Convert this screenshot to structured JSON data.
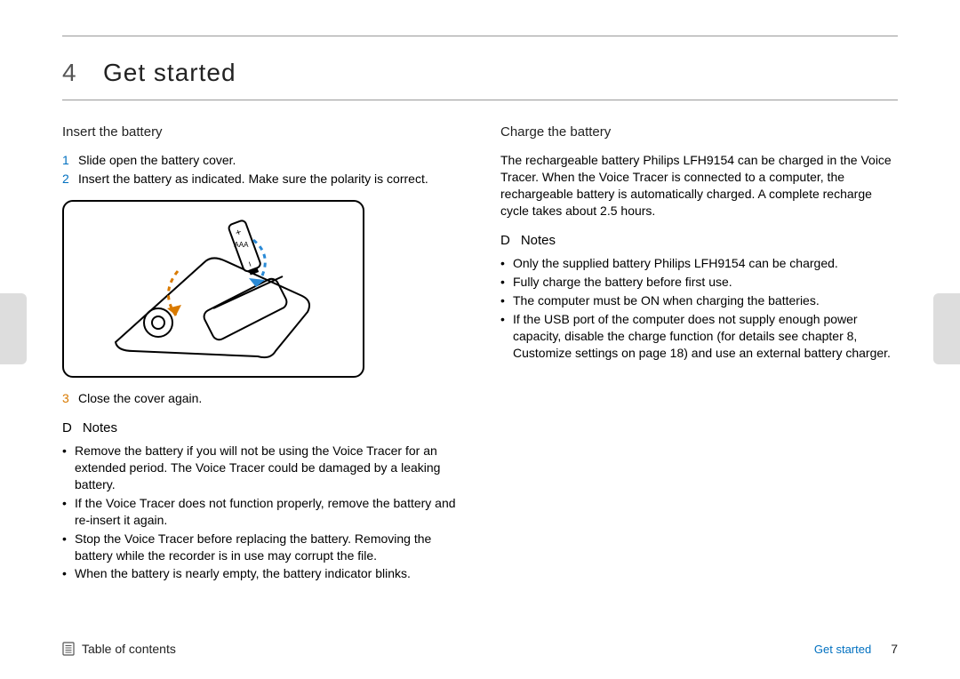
{
  "chapter": {
    "number": "4",
    "title": "Get started"
  },
  "left": {
    "subhead": "Insert the battery",
    "steps": [
      {
        "n": "1",
        "color": "blue",
        "text": "Slide open the battery cover."
      },
      {
        "n": "2",
        "color": "blue",
        "text": "Insert the battery as indicated. Make sure the polarity is correct."
      },
      {
        "n": "3",
        "color": "orange",
        "text": "Close the cover again."
      }
    ],
    "notes_symbol": "D",
    "notes_label": "Notes",
    "notes": [
      "Remove the battery if you will not be using the Voice Tracer for an extended period. The Voice Tracer could be damaged by a leaking battery.",
      "If the Voice Tracer does not function properly, remove the battery and re-insert it again.",
      "Stop the Voice Tracer before replacing the battery. Removing the battery while the recorder is in use may corrupt the file.",
      "When the battery is nearly empty, the battery indicator blinks."
    ]
  },
  "right": {
    "subhead": "Charge the battery",
    "para": "The rechargeable battery Philips LFH9154 can be charged in the Voice Tracer. When the Voice Tracer is connected to a computer, the rechargeable battery is automatically charged. A complete recharge cycle takes about 2.5 hours.",
    "notes_symbol": "D",
    "notes_label": "Notes",
    "notes": [
      "Only the supplied battery Philips LFH9154 can be charged.",
      "Fully charge the battery before first use.",
      "The computer must be ON when charging the batteries.",
      "If the USB port of the computer does not supply enough power capacity, disable the charge function (for details see chapter 8, Customize settings on page 18) and use an external battery charger."
    ]
  },
  "footer": {
    "toc": "Table of contents",
    "section": "Get started",
    "page": "7"
  }
}
